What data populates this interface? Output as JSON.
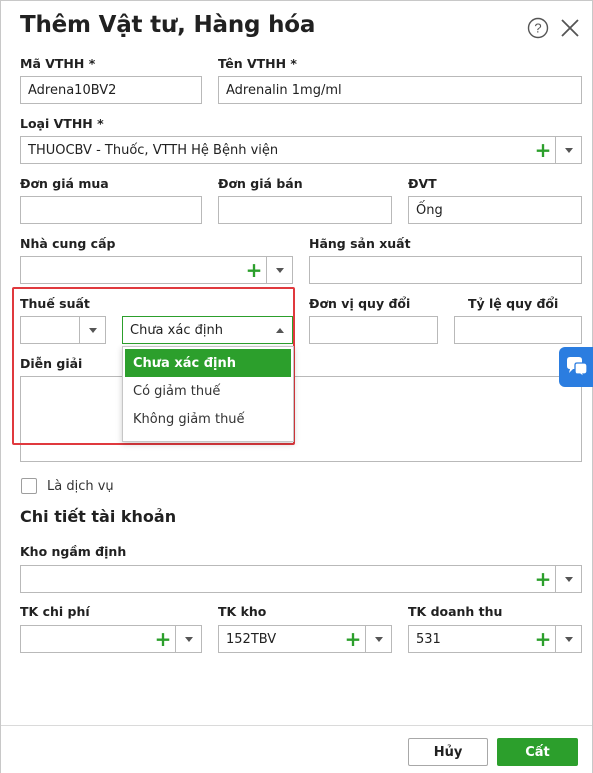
{
  "dialog": {
    "title": "Thêm Vật tư, Hàng hóa",
    "help_icon": "question-circle-icon",
    "close_icon": "close-icon"
  },
  "form": {
    "ma_vthh": {
      "label": "Mã VTHH *",
      "value": "Adrena10BV2"
    },
    "ten_vthh": {
      "label": "Tên VTHH *",
      "value": "Adrenalin 1mg/ml"
    },
    "loai_vthh": {
      "label": "Loại VTHH *",
      "value": "THUOCBV - Thuốc, VTTH Hệ Bệnh viện"
    },
    "don_gia_mua": {
      "label": "Đơn giá mua",
      "value": ""
    },
    "don_gia_ban": {
      "label": "Đơn giá bán",
      "value": ""
    },
    "dvt": {
      "label": "ĐVT",
      "value": "Ống"
    },
    "nha_cung_cap": {
      "label": "Nhà cung cấp",
      "value": ""
    },
    "hang_san_xuat": {
      "label": "Hãng sản xuất",
      "value": ""
    },
    "thue_suat": {
      "label": "Thuế suất",
      "value": ""
    },
    "giam_thue": {
      "value": "Chưa xác định"
    },
    "don_vi_quy_doi": {
      "label": "Đơn vị quy đổi",
      "value": ""
    },
    "ty_le_quy_doi": {
      "label": "Tỷ lệ quy đổi",
      "value": ""
    },
    "dien_giai": {
      "label": "Diễn giải",
      "value": ""
    },
    "la_dich_vu": {
      "label": "Là dịch vụ",
      "checked": false
    }
  },
  "giam_thue_options": [
    "Chưa xác định",
    "Có giảm thuế",
    "Không giảm thuế"
  ],
  "chi_tiet": {
    "title": "Chi tiết tài khoản",
    "kho_ngam_dinh": {
      "label": "Kho ngầm định",
      "value": ""
    },
    "tk_chi_phi": {
      "label": "TK chi phí",
      "value": ""
    },
    "tk_kho": {
      "label": "TK kho",
      "value": "152TBV"
    },
    "tk_doanh_thu": {
      "label": "TK doanh thu",
      "value": "531"
    }
  },
  "buttons": {
    "cancel": "Hủy",
    "save": "Cất"
  },
  "colors": {
    "accent": "#2c9f2c",
    "highlight": "#e0393e",
    "chat": "#2b7de0"
  }
}
